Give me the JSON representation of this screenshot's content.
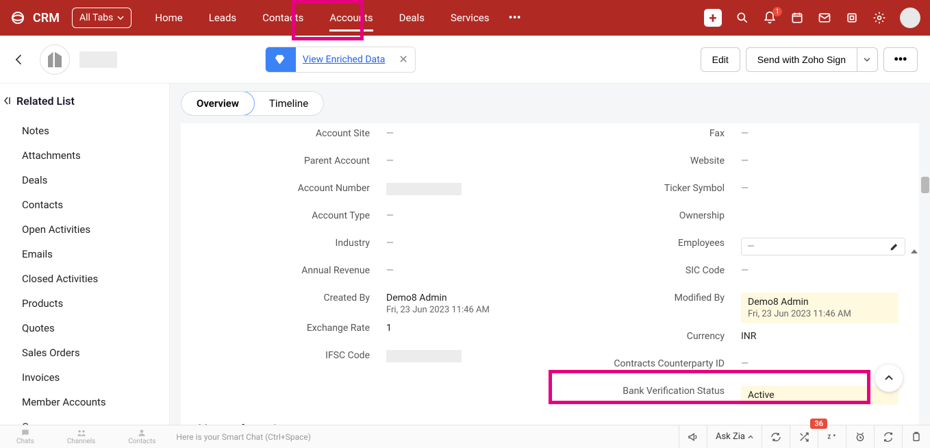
{
  "topbar": {
    "brand": "CRM",
    "alltabs": "All Tabs",
    "nav": [
      "Home",
      "Leads",
      "Contacts",
      "Accounts",
      "Deals",
      "Services"
    ],
    "active_nav_index": 3,
    "bell_count": "1"
  },
  "subheader": {
    "enriched_link": "View Enriched Data",
    "edit": "Edit",
    "send": "Send with Zoho Sign"
  },
  "sidebar": {
    "title": "Related List",
    "items": [
      "Notes",
      "Attachments",
      "Deals",
      "Contacts",
      "Open Activities",
      "Emails",
      "Closed Activities",
      "Products",
      "Quotes",
      "Sales Orders",
      "Invoices",
      "Member Accounts",
      "Cases"
    ]
  },
  "tabs": {
    "overview": "Overview",
    "timeline": "Timeline"
  },
  "left_fields": [
    {
      "label": "Account Site",
      "value": "—",
      "dash": true
    },
    {
      "label": "Parent Account",
      "value": "—",
      "dash": true
    },
    {
      "label": "Account Number",
      "value": "",
      "blur": true
    },
    {
      "label": "Account Type",
      "value": "—",
      "dash": true
    },
    {
      "label": "Industry",
      "value": "—",
      "dash": true
    },
    {
      "label": "Annual Revenue",
      "value": "—",
      "dash": true
    },
    {
      "label": "Created By",
      "value": "Demo8 Admin",
      "sub": "Fri, 23 Jun 2023 11:46 AM"
    },
    {
      "label": "Exchange Rate",
      "value": "1"
    },
    {
      "label": "IFSC Code",
      "value": "",
      "blur": true
    }
  ],
  "right_fields": [
    {
      "label": "Fax",
      "value": "—",
      "dash": true
    },
    {
      "label": "Website",
      "value": "—",
      "dash": true
    },
    {
      "label": "Ticker Symbol",
      "value": "—",
      "dash": true
    },
    {
      "label": "Ownership",
      "value": ""
    },
    {
      "label": "Employees",
      "value": "—",
      "editbox": true
    },
    {
      "label": "SIC Code",
      "value": "—",
      "dash": true
    },
    {
      "label": "Modified By",
      "value": "Demo8 Admin",
      "sub": "Fri, 23 Jun 2023 11:46 AM",
      "hl": true
    },
    {
      "label": "Currency",
      "value": "INR"
    },
    {
      "label": "Contracts Counterparty ID",
      "value": "—",
      "dash": true
    },
    {
      "label": "Bank Verification Status",
      "value": "Active",
      "hl": true
    }
  ],
  "section_header": "Address Information",
  "bottombar": {
    "left": [
      "Chats",
      "Channels",
      "Contacts"
    ],
    "smartchat": "Here is your Smart Chat (Ctrl+Space)",
    "askzia": "Ask Zia",
    "badge": "36"
  }
}
